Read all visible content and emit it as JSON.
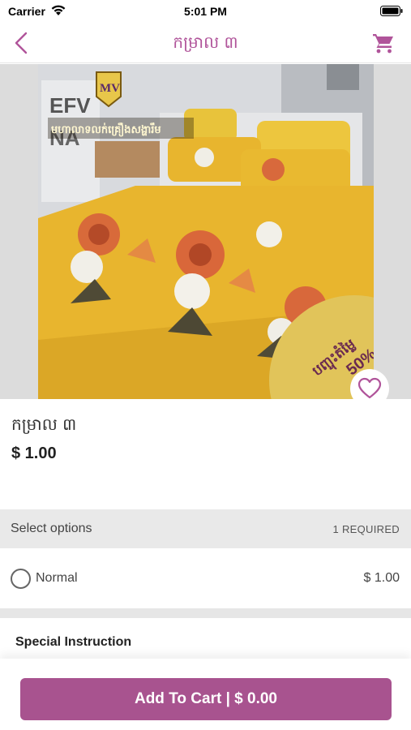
{
  "status_bar": {
    "carrier": "Carrier",
    "time": "5:01 PM"
  },
  "nav": {
    "title": "កម្រាល ៣",
    "back_icon": "chevron-left-icon",
    "cart_icon": "cart-icon"
  },
  "hero": {
    "brand_text": "MV",
    "banner_text": "មហាលាទលក់គ្រឿងសង្ហារឹម",
    "badge_line1": "បញ្ចុះតំម្លៃ",
    "badge_line2": "50%",
    "favorite_icon": "heart-icon"
  },
  "product": {
    "name": "កម្រាល ៣",
    "price": "$ 1.00"
  },
  "options": {
    "title": "Select options",
    "required": "1 REQUIRED",
    "items": [
      {
        "label": "Normal",
        "price": "$ 1.00",
        "selected": false
      }
    ]
  },
  "special": {
    "title": "Special Instruction"
  },
  "cart": {
    "label": "Add To Cart  |  $ 0.00"
  },
  "colors": {
    "accent": "#a8538f",
    "title": "#b0549a",
    "bedspread": "#e8b52e"
  }
}
